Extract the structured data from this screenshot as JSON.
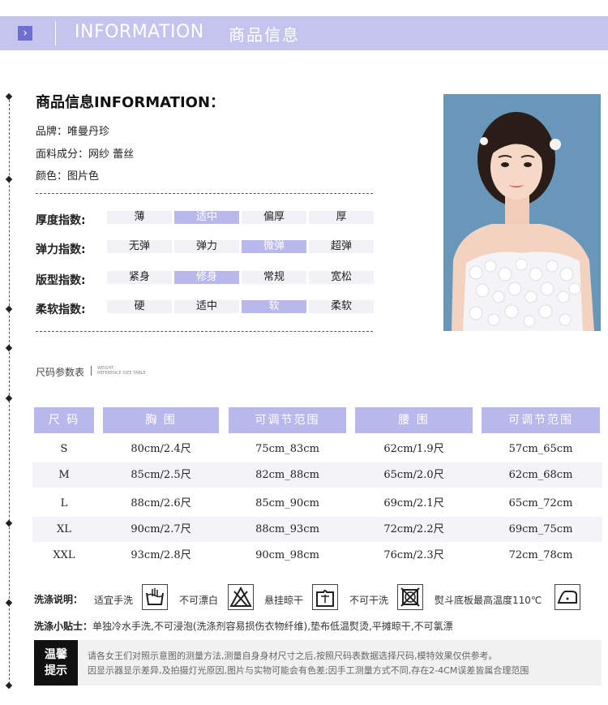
{
  "header": {
    "title": "INFORMATION",
    "subtitle": "商品信息",
    "arrow": "›"
  },
  "info": {
    "title": "商品信息INFORMATION：",
    "brand": "品牌：唯曼丹珍",
    "fabric": "面料成分：网纱 蕾丝",
    "color": "颜色：图片色"
  },
  "indices": [
    {
      "label": "厚度指数:",
      "options": [
        "薄",
        "适中",
        "偏厚",
        "厚"
      ],
      "selected": 1
    },
    {
      "label": "弹力指数:",
      "options": [
        "无弹",
        "弹力",
        "微弹",
        "超弹"
      ],
      "selected": 2
    },
    {
      "label": "版型指数:",
      "options": [
        "紧身",
        "修身",
        "常规",
        "宽松"
      ],
      "selected": 1
    },
    {
      "label": "柔软指数:",
      "options": [
        "硬",
        "适中",
        "软",
        "柔软"
      ],
      "selected": 2
    }
  ],
  "size_table": {
    "title": "尺码参数表",
    "title_en_1": "WEIGHT",
    "title_en_2": "REFERENCE SIZE TABLE",
    "headers": [
      "尺 码",
      "胸 围",
      "可调节范围",
      "腰 围",
      "可调节范围"
    ],
    "rows": [
      [
        "S",
        "80cm/2.4尺",
        "75cm_83cm",
        "62cm/1.9尺",
        "57cm_65cm"
      ],
      [
        "M",
        "85cm/2.5尺",
        "82cm_88cm",
        "65cm/2.0尺",
        "62cm_68cm"
      ],
      [
        "L",
        "88cm/2.6尺",
        "85cm_90cm",
        "69cm/2.1尺",
        "65cm_72cm"
      ],
      [
        "XL",
        "90cm/2.7尺",
        "88cm_93cm",
        "72cm/2.2尺",
        "69cm_75cm"
      ],
      [
        "XXL",
        "93cm/2.8尺",
        "90cm_98cm",
        "76cm/2.3尺",
        "72cm_78cm"
      ]
    ]
  },
  "washing": {
    "label": "洗涤说明：",
    "items": [
      {
        "text": "适宜手洗",
        "icon": "hand-wash-icon"
      },
      {
        "text": "不可漂白",
        "icon": "no-bleach-icon"
      },
      {
        "text": "悬挂晾干",
        "icon": "hang-dry-icon"
      },
      {
        "text": "不可干洗",
        "icon": "no-dry-clean-icon"
      },
      {
        "text": "熨斗底板最高温度110℃",
        "icon": "iron-icon"
      }
    ]
  },
  "tips": {
    "label": "洗涤小贴士：",
    "text": "单独冷水手洗,不可浸泡(洗涤剂容易损伤衣物纤维),垫布低温熨烫,平摊晾干,不可氯漂"
  },
  "notice": {
    "badge_1": "温馨",
    "badge_2": "提示",
    "line1": "请各女王们对照示意图的测量方法,测量自身身材尺寸之后,按照尺码表数据选择尺码,模特效果仅供参考。",
    "line2": "因显示器显示差异,及拍摄灯光原因,图片与实物可能会有色差;因手工测量方式不同,存在2-4CM误差皆属合理范围"
  },
  "colors": {
    "accent": "#b9b8ec",
    "header": "#c5c4ee",
    "shade": "#f4f4f8"
  }
}
